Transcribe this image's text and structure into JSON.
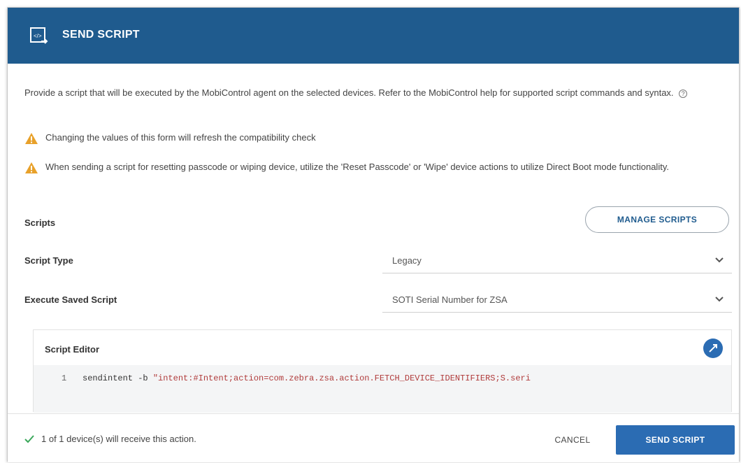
{
  "dialog": {
    "title": "SEND SCRIPT",
    "icon": "script-send-icon",
    "description": "Provide a script that will be executed by the MobiControl agent on the selected devices. Refer to the MobiControl help for supported script commands and syntax.",
    "warnings": [
      "Changing the values of this form will refresh the compatibility check",
      "When sending a script for resetting passcode or wiping device, utilize the 'Reset Passcode' or 'Wipe' device actions to utilize Direct Boot mode functionality."
    ]
  },
  "form": {
    "scripts_label": "Scripts",
    "manage_scripts_label": "MANAGE SCRIPTS",
    "script_type_label": "Script Type",
    "script_type_value": "Legacy",
    "execute_saved_label": "Execute Saved Script",
    "execute_saved_value": "SOTI Serial Number for ZSA"
  },
  "editor": {
    "title": "Script Editor",
    "line_number": "1",
    "code_command": "sendintent -b ",
    "code_string": "\"intent:#Intent;action=com.zebra.zsa.action.FETCH_DEVICE_IDENTIFIERS;S.seri"
  },
  "footer": {
    "status": "1 of 1 device(s) will receive this action.",
    "cancel_label": "CANCEL",
    "send_label": "SEND SCRIPT"
  },
  "colors": {
    "header": "#1f5b8e",
    "primary_button": "#2b6cb3",
    "warning": "#e8a12a",
    "success": "#3aa75a"
  }
}
